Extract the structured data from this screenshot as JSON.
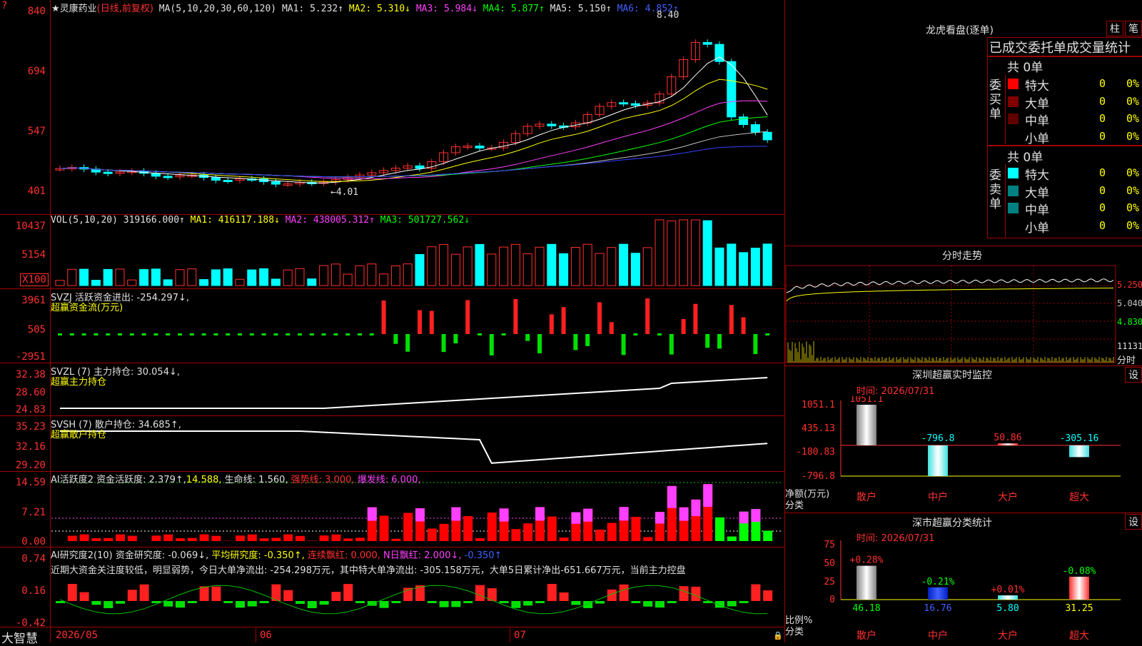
{
  "brand": "大智慧",
  "stock": {
    "name": "★灵康药业",
    "period_tag": "(日线,前复权)",
    "ma_params": "MA(5,10,20,30,60,120)",
    "ma1": "MA1: 5.232↑",
    "ma2": "MA2: 5.310↓",
    "ma3": "MA3: 5.984↓",
    "ma4": "MA4: 5.877↑",
    "ma5": "MA5: 5.150↑",
    "ma6": "MA6: 4.852↑",
    "high_mark": "8.40",
    "low_mark": "4.01",
    "y_ticks": [
      "840",
      "694",
      "547",
      "401"
    ]
  },
  "vol": {
    "header": "VOL(5,10,20)",
    "value": "319166.000↑",
    "ma1": "MA1: 416117.188↓",
    "ma2": "MA2: 438005.312↑",
    "ma3": "MA3: 501727.562↓",
    "y_ticks": [
      "10437",
      "5154",
      "X100"
    ]
  },
  "svzj": {
    "line1": "SVZJ  活跃资金进出: -254.297↓,",
    "line2": "超赢资金流(万元)",
    "y_ticks": [
      "3961",
      "505",
      "-2951"
    ]
  },
  "svzl": {
    "line1": "SVZL (7) 主力持仓: 30.054↓,",
    "line2": "超赢主力持仓",
    "y_ticks": [
      "32.38",
      "28.60",
      "24.83"
    ]
  },
  "svsh": {
    "line1": "SVSH (7) 散户持仓: 34.685↑,",
    "line2": "超赢散户持仓",
    "y_ticks": [
      "35.23",
      "32.16",
      "29.20"
    ]
  },
  "ai2": {
    "title": "AI活跃度2 资金活跃度: 2.379↑,",
    "v2": "14.588,",
    "life": "生命线: 1.560,",
    "strong": "强势线: 3.000,",
    "burst": "爆发线: 6.000,",
    "y_ticks": [
      "14.59",
      "7.21",
      "0.00"
    ]
  },
  "ai_research": {
    "title": "AI研究度2(10) 资金研究度: -0.069↓,",
    "avg": "平均研究度: -0.350↑,",
    "cont": "连续飘红: 0.000,",
    "nday": "N日飘红: 2.000↓,",
    "last": "-0.350↑",
    "comment": "近期大资金关注度较低，明显弱势，今日大单净流出: -254.298万元，其中特大单净流出: -305.158万元，大单5日累计净出-651.667万元，当前主力控盘",
    "y_ticks": [
      "0.74",
      "0.16",
      "-0.42"
    ]
  },
  "x_axis": [
    "2026/05",
    "06",
    "07"
  ],
  "dragon": {
    "title": "龙虎看盘(逐单)",
    "btn_zhu": "柱",
    "btn_bi": "笔",
    "tabs": "已成交委托单成交量统计",
    "buy_label": "委买单",
    "sell_label": "委卖单",
    "buy_total": "共 0单",
    "sell_total": "共 0单",
    "buy_rows": [
      {
        "name": "特大",
        "count": "0",
        "pct": "0%",
        "color": "#ff0000"
      },
      {
        "name": "大单",
        "count": "0",
        "pct": "0%",
        "color": "#800000"
      },
      {
        "name": "中单",
        "count": "0",
        "pct": "0%",
        "color": "#600000"
      },
      {
        "name": "小单",
        "count": "0",
        "pct": "0%",
        "color": "#000000"
      }
    ],
    "sell_rows": [
      {
        "name": "特大",
        "count": "0",
        "pct": "0%",
        "color": "#00ffff"
      },
      {
        "name": "大单",
        "count": "0",
        "pct": "0%",
        "color": "#008080"
      },
      {
        "name": "中单",
        "count": "0",
        "pct": "0%",
        "color": "#008080"
      },
      {
        "name": "小单",
        "count": "0",
        "pct": "0%",
        "color": "#000000"
      }
    ]
  },
  "intraday": {
    "title": "分时走势",
    "y_ticks": [
      "5.250",
      "5.040",
      "4.830",
      "11131"
    ],
    "label": "分时"
  },
  "monitor": {
    "title": "深圳超赢实时监控",
    "btn": "设",
    "time": "时间: 2026/07/31",
    "y_ticks": [
      "1051.1",
      "435.13",
      "-180.83",
      "-796.8"
    ],
    "ylabel": "净额(万元)",
    "xlabel": "分类",
    "bars": [
      {
        "cat": "散户",
        "value": 1051.1,
        "label": "1051.1"
      },
      {
        "cat": "中户",
        "value": -796.8,
        "label": "-796.8"
      },
      {
        "cat": "大户",
        "value": 50.86,
        "label": "50.86"
      },
      {
        "cat": "超大",
        "value": -305.16,
        "label": "-305.16"
      }
    ]
  },
  "classify": {
    "title": "深市超赢分类统计",
    "btn": "设",
    "time": "时间: 2026/07/31",
    "y_ticks": [
      "75",
      "50",
      "25",
      "0"
    ],
    "ylabel": "比例%",
    "xlabel": "分类",
    "bars": [
      {
        "cat": "散户",
        "value": 46.18,
        "label": "46.18",
        "change": "+0.28%"
      },
      {
        "cat": "中户",
        "value": 16.76,
        "label": "16.76",
        "change": "-0.21%"
      },
      {
        "cat": "大户",
        "value": 5.8,
        "label": "5.80",
        "change": "+0.01%"
      },
      {
        "cat": "超大",
        "value": 31.25,
        "label": "31.25",
        "change": "-0.08%"
      }
    ]
  }
}
